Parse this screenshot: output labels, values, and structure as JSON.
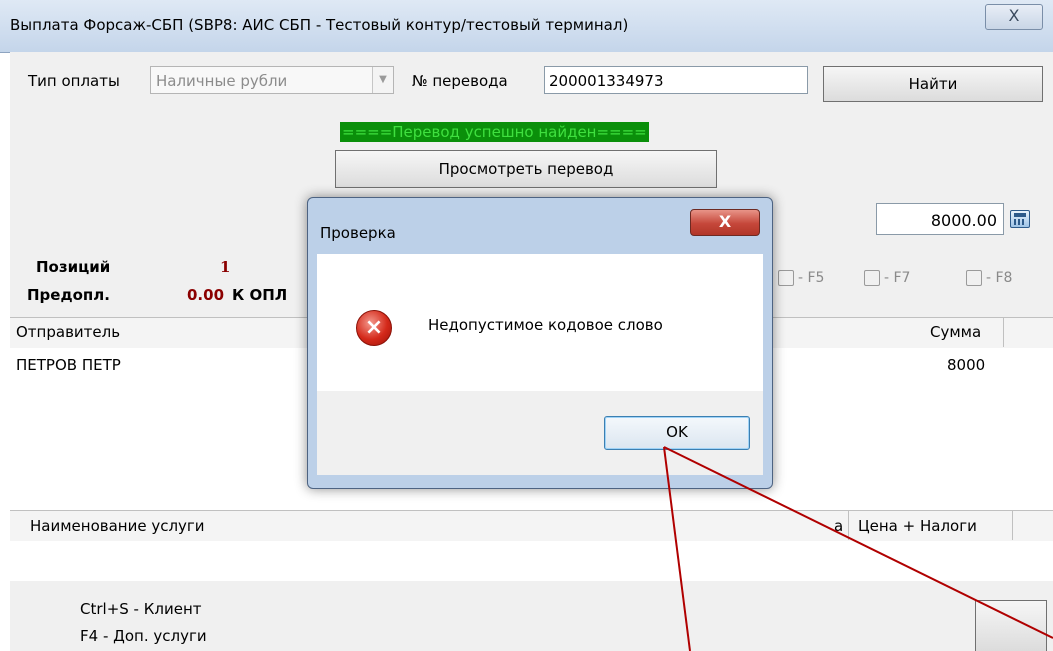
{
  "window": {
    "title": "Выплата Форсаж-СБП (SBP8: АИС СБП - Тестовый контур/тестовый терминал)",
    "close_glyph": "X"
  },
  "form": {
    "payment_type_label": "Тип оплаты",
    "payment_type_value": "Наличные рубли",
    "transfer_no_label": "№ перевода",
    "transfer_no_value": "200001334973",
    "find_button": "Найти",
    "status_text": "====Перевод успешно найден====",
    "view_button": "Просмотреть перевод",
    "amount_value": "8000.00"
  },
  "summary": {
    "positions_label": "Позиций",
    "positions_value": "1",
    "prepaid_label": "Предопл.",
    "prepaid_value": "0.00",
    "to_pay_label": "К ОПЛ"
  },
  "toolbar": {
    "f5_label": "- F5",
    "f7_label": "- F7",
    "f8_label": "- F8"
  },
  "senders_table": {
    "col_sender": "Отправитель",
    "col_sum": "Сумма",
    "rows": [
      {
        "sender": "ПЕТРОВ ПЕТР",
        "sum": "8000"
      }
    ]
  },
  "services_table": {
    "col_name": "Наименование услуги",
    "col_partial": "а",
    "col_price": "Цена + Налоги"
  },
  "footer": {
    "hint_client": "Ctrl+S - Клиент",
    "hint_services": "F4 - Доп. услуги"
  },
  "dialog": {
    "title": "Проверка",
    "message": "Недопустимое кодовое слово",
    "ok_button": "OK",
    "close_glyph": "X"
  },
  "colors": {
    "status_bg": "#0a8f0a",
    "status_text": "#3fe03f",
    "positions_value": "#8b0000",
    "annotation_line": "#b00000"
  }
}
